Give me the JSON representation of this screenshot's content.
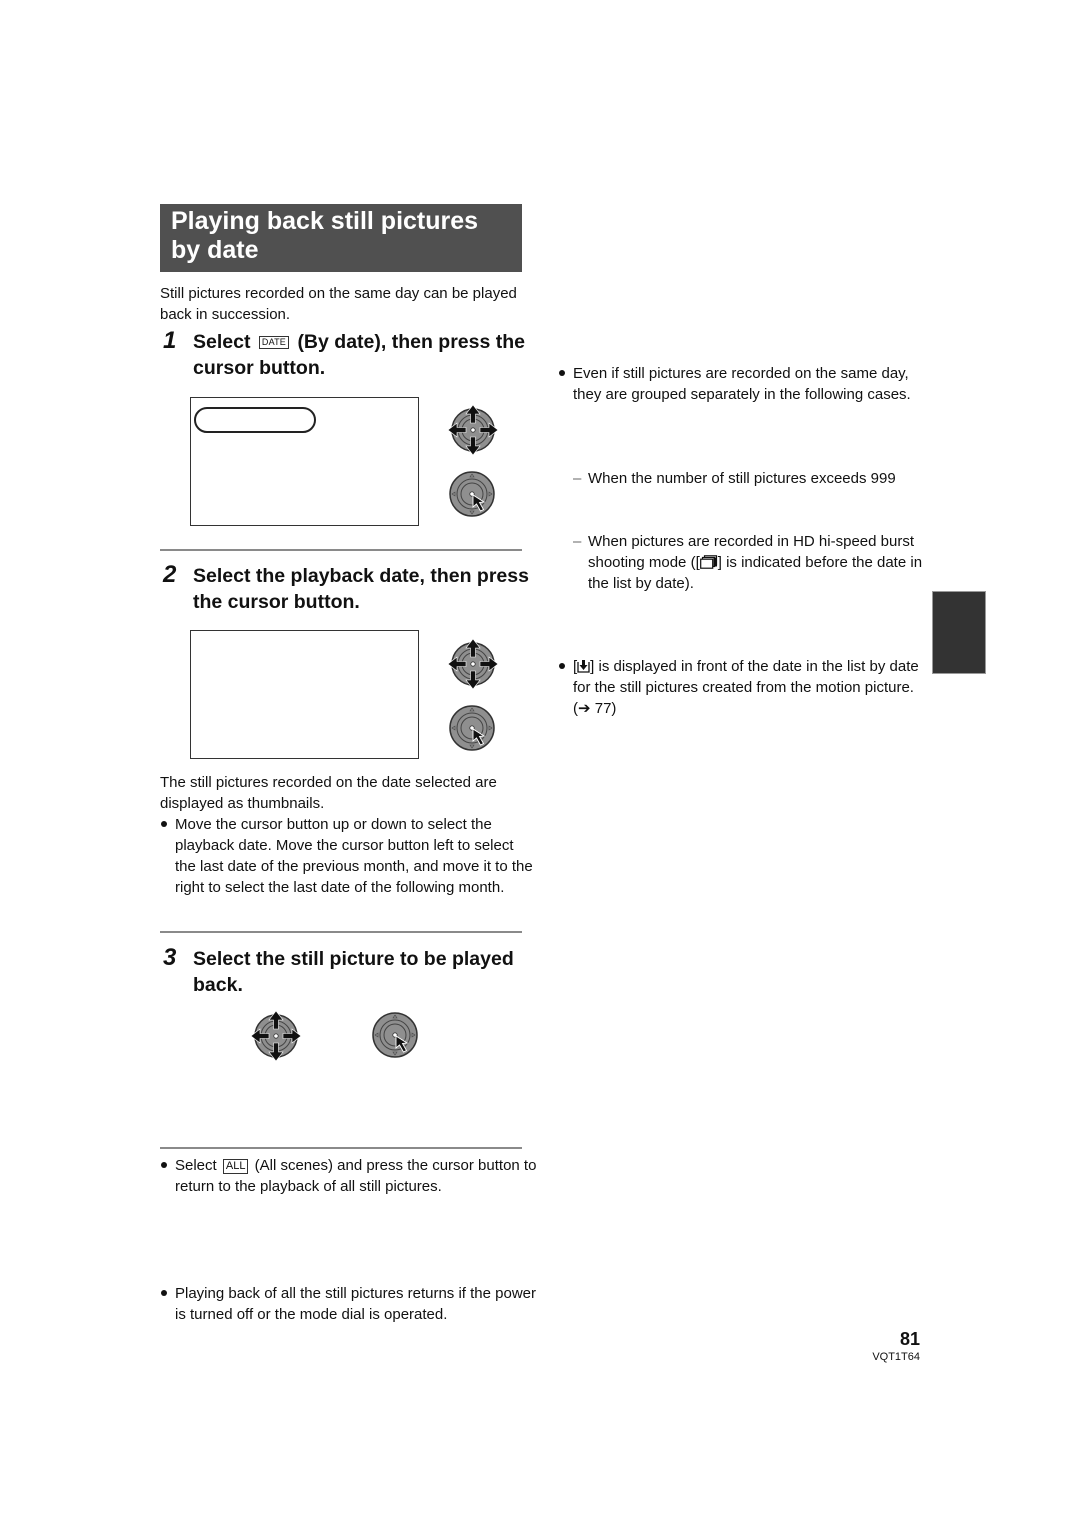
{
  "section": {
    "title_line1": "Playing back still pictures",
    "title_line2": "by date",
    "intro": "Still pictures recorded on the same day can be played back in succession."
  },
  "steps": [
    {
      "number": "1",
      "text_before_icon": "Select",
      "icon_label": "DATE",
      "text_after_icon": "(By date), then press the cursor button."
    },
    {
      "number": "2",
      "text": "Select the playback date, then press the cursor button."
    },
    {
      "number": "3",
      "text": "Select the still picture to be played back."
    }
  ],
  "step2_notes": {
    "paragraph": "The still pictures recorded on the date selected are displayed as thumbnails.",
    "bullet": "Move the cursor button up or down to select the playback date. Move the cursor button left to select the last date of the previous month, and move it to the right to select the last date of the following month."
  },
  "step3_notes": {
    "bullet_before_icon": "Select",
    "icon_label": "ALL",
    "bullet_after_icon": "(All scenes) and press the cursor button to return to the playback of all still pictures."
  },
  "general_note": "Playing back of all the still pictures returns if the power is turned off or the mode dial is operated.",
  "right_column": {
    "bullet1": "Even if still pictures are recorded on the same day, they are grouped separately in the following cases.",
    "dash_char": "–",
    "case1": "When the number of still pictures exceeds 999",
    "case2_before_icon": "When pictures are recorded in HD hi-speed burst shooting mode ([",
    "case2_after_icon": "] is indicated before the date in the list by date).",
    "bullet2_before_icon": "[",
    "bullet2_after_icon": "] is displayed in front of the date in the list by date for the still pictures created from the motion picture. (➔ 77)"
  },
  "icons": {
    "joystick_move": "cursor-button-move-icon",
    "joystick_press": "cursor-button-press-icon",
    "burst": "hd-burst-shooting-icon",
    "from_motion": "still-from-motion-icon"
  },
  "colors": {
    "title_band": "#505050",
    "side_tab": "#333333"
  },
  "footer": {
    "page_number": "81",
    "code": "VQT1T64"
  }
}
